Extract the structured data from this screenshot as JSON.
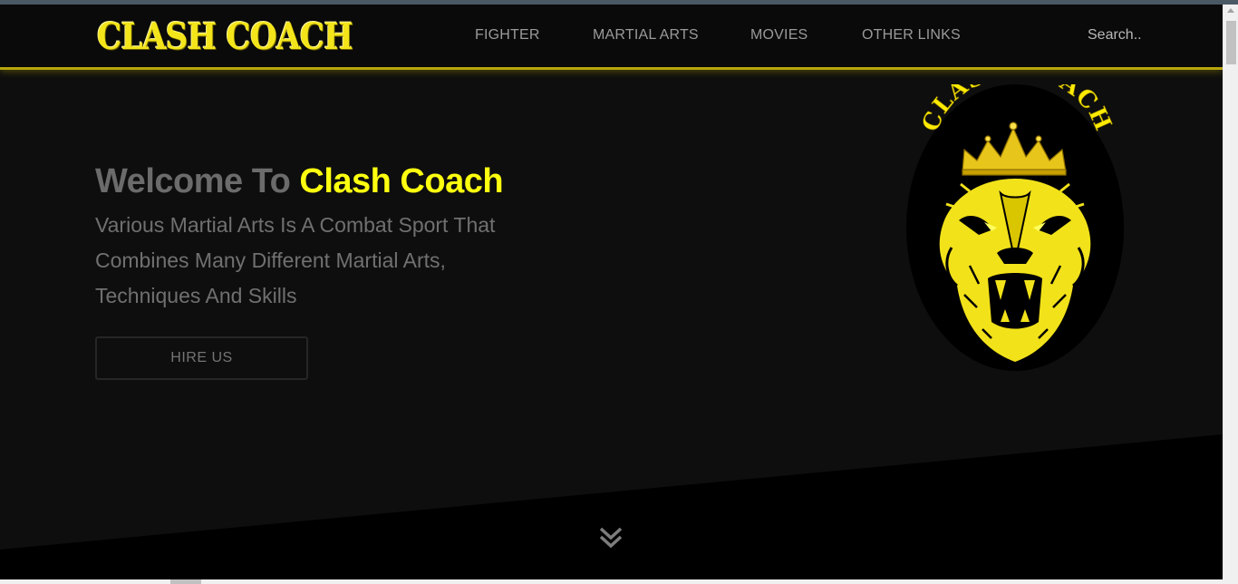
{
  "brand": {
    "logo_text": "CLASH COACH",
    "emblem_text": "CLASH COACH"
  },
  "nav": {
    "items": [
      {
        "label": "FIGHTER"
      },
      {
        "label": "MARTIAL ARTS"
      },
      {
        "label": "MOVIES"
      },
      {
        "label": "OTHER LINKS"
      }
    ],
    "search_placeholder": "Search.."
  },
  "hero": {
    "title_prefix": "Welcome To",
    "title_brand": "Clash Coach",
    "description": "Various Martial Arts Is A Combat Sport That Combines Many Different Martial Arts, Techniques And Skills",
    "cta_label": "HIRE US"
  },
  "icons": {
    "scroll_down": "chevrons-down-icon",
    "emblem": "lion-crown-icon"
  },
  "colors": {
    "accent": "#ffff10",
    "nav_border": "#b6a50c",
    "background": "#0e0e0e",
    "text_muted": "#707070"
  }
}
